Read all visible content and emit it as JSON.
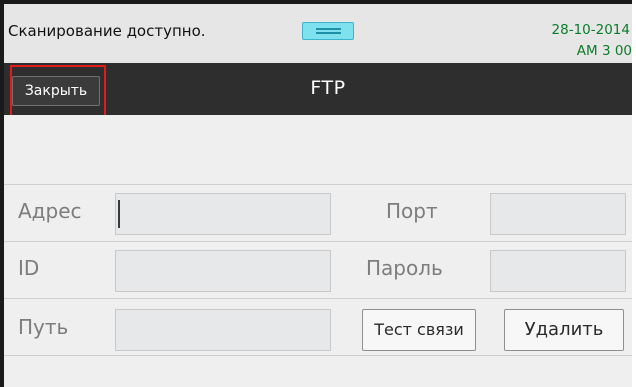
{
  "status_bar": {
    "message": "Сканирование доступно.",
    "date": "28-10-2014",
    "time": "AM 3 00"
  },
  "title_bar": {
    "close_label": "Закрыть",
    "title": "FTP"
  },
  "form": {
    "address_label": "Адрес",
    "port_label": "Порт",
    "id_label": "ID",
    "password_label": "Пароль",
    "path_label": "Путь",
    "test_button": "Тест связи",
    "delete_button": "Удалить",
    "address_value": "",
    "port_value": "",
    "id_value": "",
    "password_value": "",
    "path_value": ""
  },
  "colors": {
    "title_bar": "#2e2e2e",
    "highlight": "#e01b1b",
    "status_time": "#0b7c2a",
    "handle": "#7fe0ee"
  }
}
